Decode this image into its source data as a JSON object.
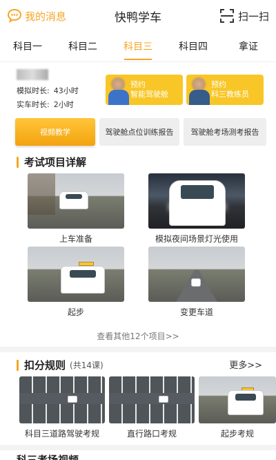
{
  "header": {
    "messages_label": "我的消息",
    "title": "快鸭学车",
    "scan_label": "扫一扫",
    "accent": "#f5a623"
  },
  "tabs": [
    {
      "label": "科目一",
      "active": false
    },
    {
      "label": "科目二",
      "active": false
    },
    {
      "label": "科目三",
      "active": true
    },
    {
      "label": "科目四",
      "active": false
    },
    {
      "label": "拿证",
      "active": false
    }
  ],
  "user": {
    "name": " ",
    "sim_label": "模拟时长:",
    "sim_value": "43小时",
    "real_label": "实车时长:",
    "real_value": "2小时"
  },
  "booking": [
    {
      "line1": "预约",
      "line2": "智能驾驶舱"
    },
    {
      "line1": "预约",
      "line2": "科三教练员"
    }
  ],
  "reports": [
    {
      "label": "视频教学",
      "primary": true
    },
    {
      "label": "驾驶舱点位训练报告",
      "primary": false
    },
    {
      "label": "驾驶舱考场测考报告",
      "primary": false
    }
  ],
  "exam_section": {
    "title": "考试项目详解",
    "items": [
      {
        "caption": "上车准备",
        "icon": "car-roadside-photo"
      },
      {
        "caption": "模拟夜间场景灯光使用",
        "icon": "car-night-lights-photo"
      },
      {
        "caption": "起步",
        "icon": "car-start-photo"
      },
      {
        "caption": "变更车道",
        "icon": "lane-change-photo"
      }
    ],
    "view_more": "查看其他12个项目>>"
  },
  "deduction_section": {
    "title": "扣分规则",
    "count": "(共14课)",
    "more": "更多>>",
    "items": [
      {
        "caption": "科目三道路驾驶考规"
      },
      {
        "caption": "直行路口考规"
      },
      {
        "caption": "起步考规"
      }
    ]
  },
  "bottom_section": {
    "title": "科三考场视频"
  }
}
